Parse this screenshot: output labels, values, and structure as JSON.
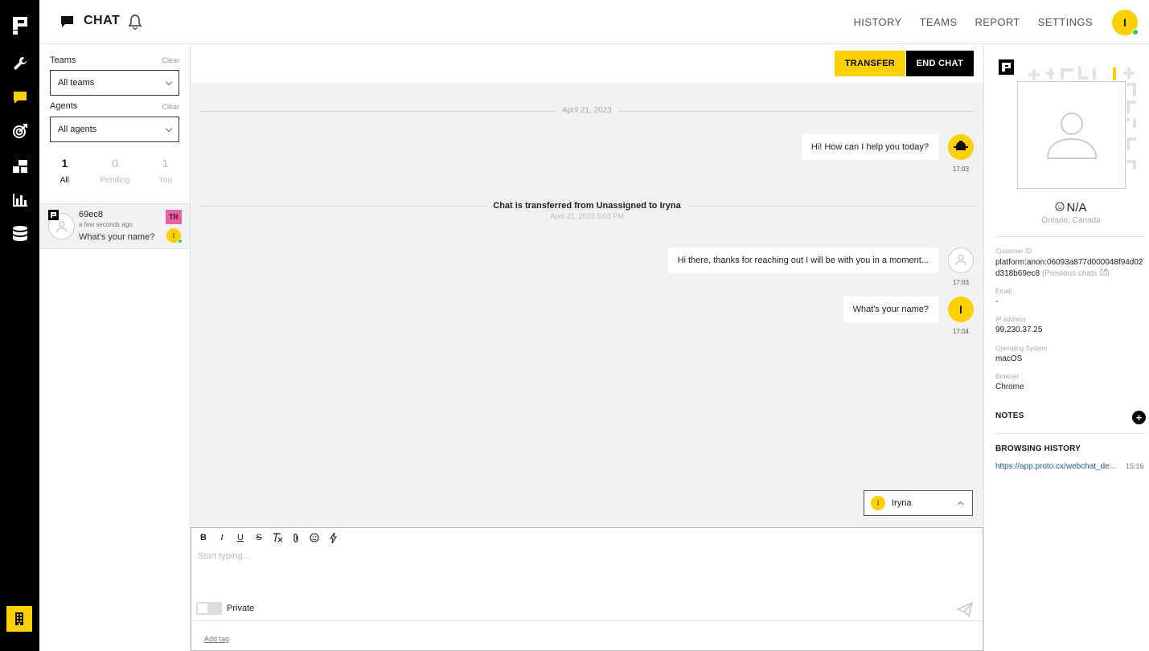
{
  "app": {
    "title": "CHAT",
    "nav": [
      "HISTORY",
      "TEAMS",
      "REPORT",
      "SETTINGS"
    ],
    "user_initial": "I",
    "accent": "#ffd000",
    "online_color": "#2ecc40"
  },
  "sidebar_icons": [
    "logo-icon",
    "wrench-icon",
    "chat-icon",
    "target-icon",
    "flow-icon",
    "bar-chart-icon",
    "database-icon",
    "building-icon"
  ],
  "filters": {
    "teams_label": "Teams",
    "teams_clear": "Clear",
    "teams_value": "All teams",
    "agents_label": "Agents",
    "agents_clear": "Clear",
    "agents_value": "All agents",
    "counts": [
      {
        "num": "1",
        "label": "All"
      },
      {
        "num": "0",
        "label": "Pending"
      },
      {
        "num": "1",
        "label": "You"
      }
    ]
  },
  "chat_list": [
    {
      "name": "69ec8",
      "time": "a few seconds ago",
      "message": "What's your name?",
      "team_badge": "TR",
      "team_color": "#ef5fa6",
      "agent_initial": "I"
    }
  ],
  "chat": {
    "transfer_label": "TRANSFER",
    "end_label": "END CHAT",
    "date_sep": "April 21, 2023",
    "messages": [
      {
        "text": "Hi! How can I help you today?",
        "time": "17:03",
        "avatar": "bot-icon"
      },
      {
        "text": "Hi there, thanks for reaching out I will be with you in a moment...",
        "time": "17:03",
        "avatar": "user-icon"
      },
      {
        "text": "What's your name?",
        "time": "17:04",
        "avatar": "I"
      }
    ],
    "system": {
      "text": "Chat is transferred from Unassigned to Iryna",
      "sub": "April 21, 2023 5:03 PM"
    },
    "agent_selector": {
      "initial": "I",
      "name": "Iryna"
    }
  },
  "composer": {
    "placeholder": "Start typing...",
    "tools": [
      "B",
      "I",
      "U",
      "S",
      "clear-format-icon",
      "attach-icon",
      "emoji-icon",
      "lightning-icon"
    ],
    "private_label": "Private",
    "private_on": false,
    "add_tag": "Add tag"
  },
  "profile": {
    "name": "N/A",
    "location": "Ontario, Canada",
    "customer_id_label": "Customer ID",
    "customer_id_line1": "platform:anon:06093a877d000048f94d02",
    "customer_id_line2": "d318b69ec8",
    "previous_chats": "(Previous chats",
    "email_label": "Email",
    "email": "-",
    "ip_label": "IP address",
    "ip": "99.230.37.25",
    "os_label": "Operating System",
    "os": "macOS",
    "browser_label": "Browser",
    "browser": "Chrome",
    "notes_heading": "NOTES",
    "browsing_heading": "BROWSING HISTORY",
    "browsing_url": "https://app.proto.cx/webchat_de...",
    "browsing_time": "15:16"
  }
}
